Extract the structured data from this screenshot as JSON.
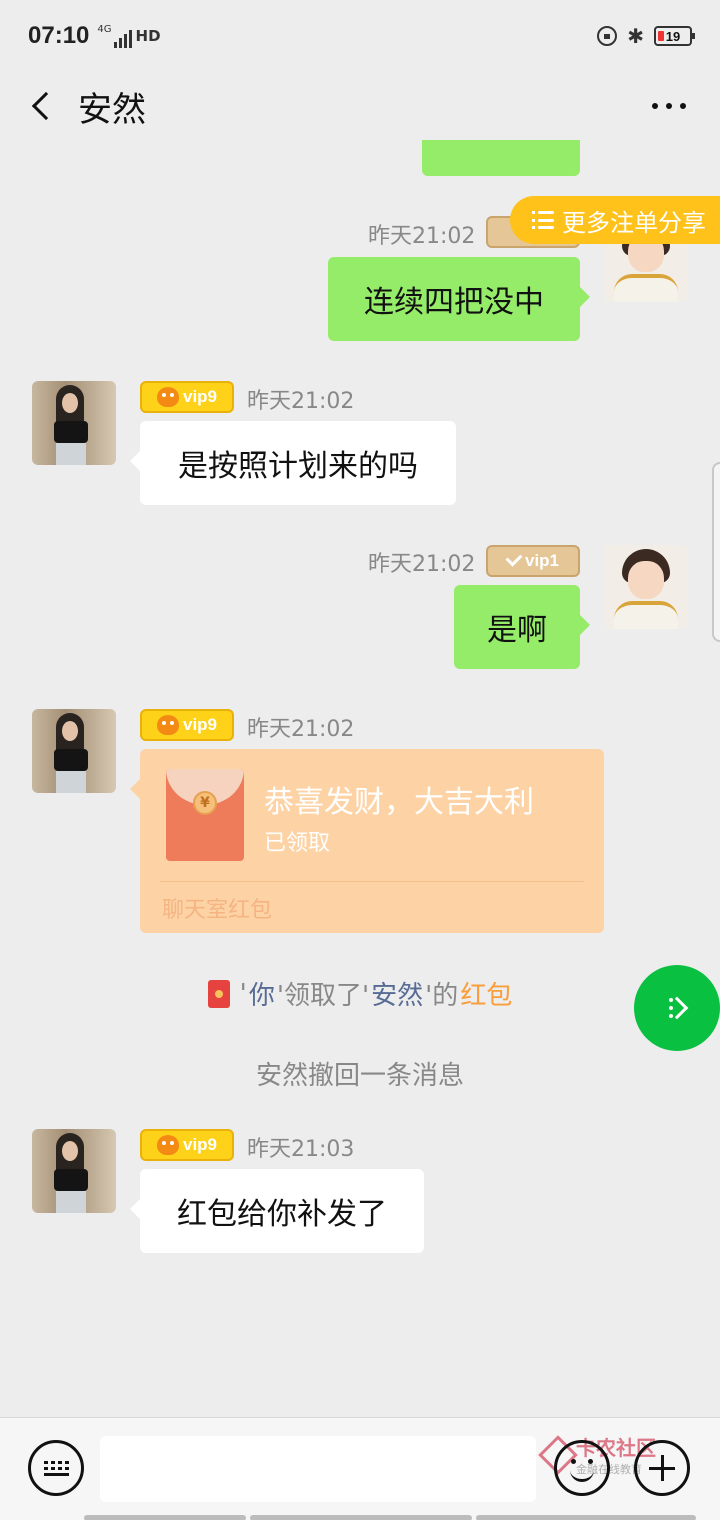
{
  "status_bar": {
    "time": "07:10",
    "network": "4G",
    "hd": "HD",
    "battery": "19"
  },
  "header": {
    "title": "安然"
  },
  "messages": [
    {
      "side": "right",
      "time": "昨天21:02",
      "text": "连续四把没中"
    },
    {
      "side": "left",
      "vip": "vip9",
      "time": "昨天21:02",
      "text": "是按照计划来的吗"
    },
    {
      "side": "right",
      "vip": "vip1",
      "time": "昨天21:02",
      "text": "是啊"
    },
    {
      "side": "left",
      "vip": "vip9",
      "time": "昨天21:02",
      "red_packet": {
        "title": "恭喜发财，大吉大利",
        "status": "已领取",
        "footer": "聊天室红包",
        "coin": "¥"
      }
    },
    {
      "side": "left",
      "vip": "vip9",
      "time": "昨天21:03",
      "text": "红包给你补发了"
    }
  ],
  "system_notice": {
    "q1": "'",
    "you": "你",
    "received": "'领取了'",
    "name": "安然",
    "of": "'的",
    "red_packet": "红包"
  },
  "recall_notice": "安然撤回一条消息",
  "share_button": "更多注单分享",
  "watermark": {
    "name": "卡农社区",
    "sub": "金融在线教育"
  },
  "input": {
    "value": "",
    "placeholder": ""
  },
  "colors": {
    "self_bubble": "#95ec69",
    "other_bubble": "#ffffff",
    "red_packet_bg": "#fdd3a6",
    "fab": "#09c040",
    "share_button": "#ffc21a",
    "vip_gold": "#ffd21a",
    "link_blue": "#576b95",
    "link_orange": "#fa9d3b"
  }
}
